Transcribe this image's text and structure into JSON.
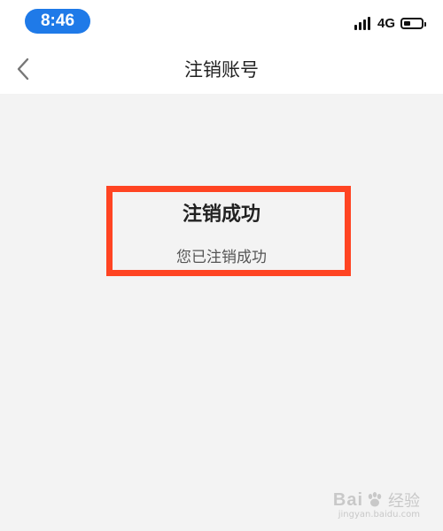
{
  "status_bar": {
    "time": "8:46",
    "network": "4G",
    "battery_level_fraction": 0.4,
    "colors": {
      "time_pill": "#1f7ae8"
    }
  },
  "nav_bar": {
    "back_icon": "chevron-left-icon",
    "title": "注销账号"
  },
  "result": {
    "title": "注销成功",
    "message": "您已注销成功",
    "highlight_color": "#ff4422"
  },
  "watermark": {
    "brand": "Bai",
    "brand_suffix": "经验",
    "site": "jingyan.baidu.com"
  }
}
